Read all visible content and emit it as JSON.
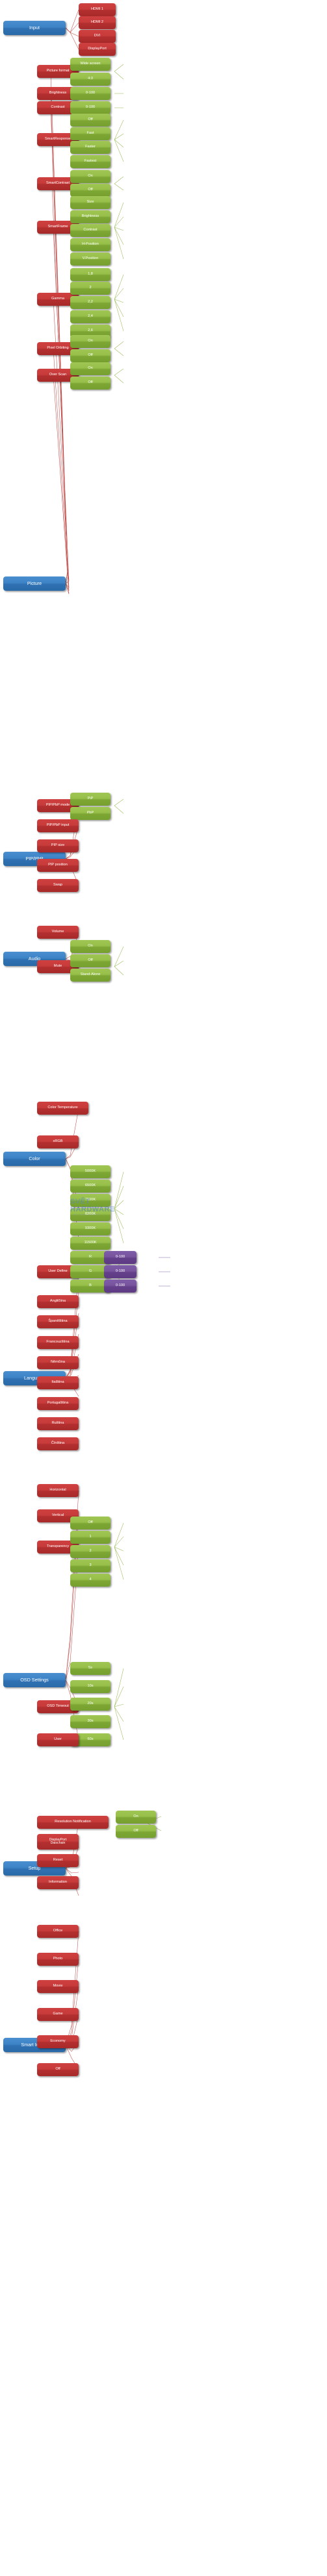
{
  "diagram": {
    "title": "Monitor OSD menu tree",
    "type": "tree",
    "colors": {
      "root": "#3c83c6",
      "level1": "#c83b3b",
      "level2": "#96bf49",
      "level3": "#78549f",
      "link_red": "#c0504d",
      "link_green": "#9bbb59",
      "link_purple": "#8064a2",
      "background": "#ffffff",
      "text": "#ffffff"
    },
    "watermark": {
      "line1": "SVĚT",
      "line2": "HARDWARE",
      "line3": "...vše o light počítačích"
    },
    "groups": [
      {
        "root": "Input",
        "children": [
          {
            "label": "HDMI 1",
            "options": []
          },
          {
            "label": "HDMI 2",
            "options": []
          },
          {
            "label": "DVI",
            "options": []
          },
          {
            "label": "DisplayPort",
            "options": []
          }
        ]
      },
      {
        "root": "Picture",
        "children": [
          {
            "label": "Picture format",
            "options": [
              "Wide screen",
              "4:3"
            ]
          },
          {
            "label": "Brightness",
            "options": [
              "0-100"
            ]
          },
          {
            "label": "Contrast",
            "options": [
              "0-100"
            ]
          },
          {
            "label": "SmartResponse",
            "options": [
              "Off",
              "Fast",
              "Faster",
              "Fastest"
            ]
          },
          {
            "label": "SmartContrast",
            "options": [
              "On",
              "Off"
            ]
          },
          {
            "label": "SmartFrame",
            "options": [
              "Size",
              "Brightness",
              "Contrast",
              "H-Position",
              "V.Position"
            ]
          },
          {
            "label": "Gamma",
            "options": [
              "1,8",
              "2",
              "2,2",
              "2,4",
              "2,6"
            ]
          },
          {
            "label": "Pixel Orbiting",
            "options": [
              "On",
              "Off"
            ]
          },
          {
            "label": "Over Scan",
            "options": [
              "On",
              "Off"
            ]
          }
        ]
      },
      {
        "root": "PIP/PbP",
        "children": [
          {
            "label": "PIP/PbP mode",
            "options": [
              "PiP",
              "PbP"
            ]
          },
          {
            "label": "PIP/PbP input",
            "options": []
          },
          {
            "label": "PIP size",
            "options": []
          },
          {
            "label": "PIP position",
            "options": []
          },
          {
            "label": "Swap",
            "options": []
          }
        ]
      },
      {
        "root": "Audio",
        "children": [
          {
            "label": "Volume",
            "options": []
          },
          {
            "label": "Mute",
            "options": [
              "On",
              "Off",
              "Stand-Alone"
            ]
          }
        ]
      },
      {
        "root": "Color",
        "children": [
          {
            "label": "Color Temperature",
            "options": [
              "5000K",
              "6500K",
              "7500K",
              "8200K",
              "9300K",
              "11500K"
            ]
          },
          {
            "label": "sRGB",
            "options": []
          },
          {
            "label": "User Define",
            "options": [
              "R",
              "G",
              "B"
            ],
            "sub_options": [
              "0-100",
              "0-100",
              "0-100"
            ]
          },
          {
            "label": "Angličtina",
            "options": []
          }
        ]
      },
      {
        "root": "Language",
        "children": [
          {
            "label": "Španělština",
            "options": []
          },
          {
            "label": "Francouzština",
            "options": []
          },
          {
            "label": "Němčina",
            "options": []
          },
          {
            "label": "Italština",
            "options": []
          },
          {
            "label": "Portugalština",
            "options": []
          },
          {
            "label": "Ruština",
            "options": []
          },
          {
            "label": "Čínština",
            "options": []
          }
        ]
      },
      {
        "root": "OSD Settings",
        "children": [
          {
            "label": "Horizontal",
            "options": []
          },
          {
            "label": "Vertical",
            "options": []
          },
          {
            "label": "Transparency",
            "options": [
              "Off",
              "1",
              "2",
              "3",
              "4"
            ]
          },
          {
            "label": "OSD Timeout",
            "options": [
              "5s",
              "10s",
              "20s",
              "30s",
              "60s"
            ]
          },
          {
            "label": "User",
            "options": []
          }
        ]
      },
      {
        "root": "Setup",
        "children": [
          {
            "label": "Resolution Notification",
            "options": [
              "On",
              "Off"
            ]
          },
          {
            "label": "DisplayPort Daischain",
            "options": []
          },
          {
            "label": "Reset",
            "options": []
          },
          {
            "label": "Information",
            "options": []
          }
        ]
      },
      {
        "root": "Smart Image",
        "children": [
          {
            "label": "Office",
            "options": []
          },
          {
            "label": "Photo",
            "options": []
          },
          {
            "label": "Movie",
            "options": []
          },
          {
            "label": "Game",
            "options": []
          },
          {
            "label": "Economy",
            "options": []
          },
          {
            "label": "Off",
            "options": []
          }
        ]
      }
    ]
  },
  "nodes": {
    "input_root": "Input",
    "input_hdmi1": "HDMI 1",
    "input_hdmi2": "HDMI 2",
    "input_dvi": "DVI",
    "input_dp": "DisplayPort",
    "picture_root": "Picture",
    "pic_format": "Picture format",
    "pic_format_wide": "Wide screen",
    "pic_format_43": "4:3",
    "pic_brightness": "Brightness",
    "pic_brightness_val": "0-100",
    "pic_contrast": "Contrast",
    "pic_contrast_val": "0-100",
    "pic_smartresponse": "SmartResponse",
    "sr_off": "Off",
    "sr_fast": "Fast",
    "sr_faster": "Faster",
    "sr_fastest": "Fastest",
    "pic_smartcontrast": "SmartContrast",
    "sc_on": "On",
    "sc_off": "Off",
    "pic_smartframe": "SmartFrame",
    "sf_size": "Size",
    "sf_brightness": "Brightness",
    "sf_contrast": "Contrast",
    "sf_hpos": "H-Position",
    "sf_vpos": "V.Position",
    "pic_gamma": "Gamma",
    "g_18": "1,8",
    "g_2": "2",
    "g_22": "2,2",
    "g_24": "2,4",
    "g_26": "2,6",
    "pic_pixelorbiting": "Pixel Orbiting",
    "po_on": "On",
    "po_off": "Off",
    "pic_overscan": "Over Scan",
    "os_on": "On",
    "os_off": "Off",
    "pip_root": "PIP/PbP",
    "pip_mode": "PIP/PbP mode",
    "pip_mode_pip": "PiP",
    "pip_mode_pbp": "PbP",
    "pip_input": "PIP/PbP input",
    "pip_size": "PIP size",
    "pip_position": "PIP position",
    "pip_swap": "Swap",
    "audio_root": "Audio",
    "audio_volume": "Volume",
    "audio_mute": "Mute",
    "mute_on": "On",
    "mute_off": "Off",
    "mute_standalone": "Stand-Alone",
    "color_root": "Color",
    "color_temp": "Color Temperature",
    "ct_5000": "5000K",
    "ct_6500": "6500K",
    "ct_7500": "7500K",
    "ct_8200": "8200K",
    "ct_9300": "9300K",
    "ct_11500": "11500K",
    "color_srgb": "sRGB",
    "color_userdefine": "User Define",
    "ud_r": "R",
    "ud_g": "G",
    "ud_b": "B",
    "ud_r_val": "0-100",
    "ud_g_val": "0-100",
    "ud_b_val": "0-100",
    "lang_root": "Language",
    "lang_en": "Angličtina",
    "lang_es": "Španělština",
    "lang_fr": "Francouzština",
    "lang_de": "Němčina",
    "lang_it": "Italština",
    "lang_pt": "Portugalština",
    "lang_ru": "Ruština",
    "lang_zh": "Čínština",
    "osd_root": "OSD Settings",
    "osd_horizontal": "Horizontal",
    "osd_vertical": "Vertical",
    "osd_transparency": "Transparency",
    "tr_off": "Off",
    "tr_1": "1",
    "tr_2": "2",
    "tr_3": "3",
    "tr_4": "4",
    "osd_timeout": "OSD Timeout",
    "to_5s": "5s",
    "to_10s": "10s",
    "to_20s": "20s",
    "to_30s": "30s",
    "to_60s": "60s",
    "osd_user": "User",
    "setup_root": "Setup",
    "setup_resnotif": "Resolution Notification",
    "rn_on": "On",
    "rn_off": "Off",
    "setup_dpdaisy": "DisplayPort\nDaischain",
    "setup_reset": "Reset",
    "setup_information": "Information",
    "smart_root": "Smart Image",
    "si_office": "Office",
    "si_photo": "Photo",
    "si_movie": "Movie",
    "si_game": "Game",
    "si_economy": "Economy",
    "si_off": "Off"
  }
}
